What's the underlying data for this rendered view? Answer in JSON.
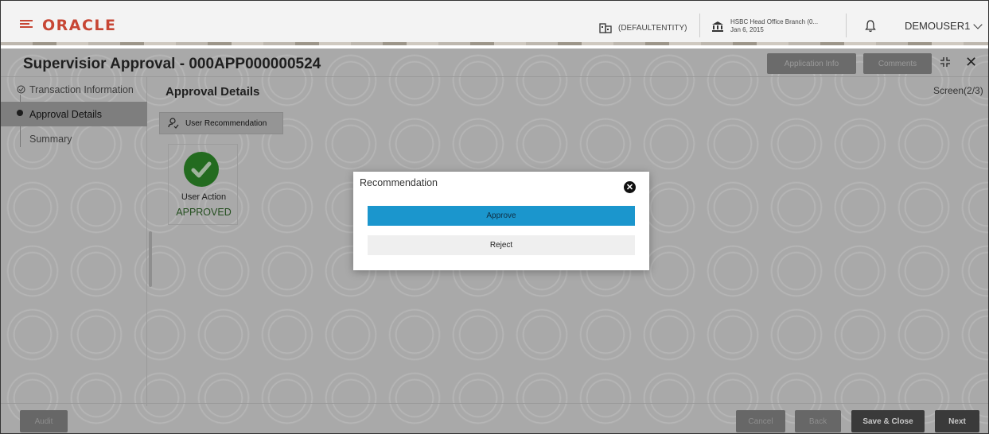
{
  "header": {
    "logo": "ORACLE",
    "entity": "(DEFAULTENTITY)",
    "branch_name": "HSBC Head Office Branch (0...",
    "branch_date": "Jan 6, 2015",
    "user": "DEMOUSER1"
  },
  "page": {
    "title": "Supervisior Approval - 000APP000000524",
    "application_info_label": "Application Info",
    "comments_label": "Comments",
    "section_title": "Approval Details",
    "screen_count": "Screen(2/3)"
  },
  "sidebar": {
    "items": [
      {
        "label": "Transaction Information"
      },
      {
        "label": "Approval Details"
      },
      {
        "label": "Summary"
      }
    ]
  },
  "recommendation_tab": {
    "label": "User Recommendation"
  },
  "action_card": {
    "label": "User Action",
    "value": "APPROVED"
  },
  "footer": {
    "audit_label": "Audit",
    "cancel_label": "Cancel",
    "back_label": "Back",
    "save_close_label": "Save & Close",
    "next_label": "Next"
  },
  "modal": {
    "title": "Recommendation",
    "approve_label": "Approve",
    "reject_label": "Reject"
  },
  "colors": {
    "brand": "#c74634",
    "approve_button": "#1b96cd",
    "approved_status": "#236b1f"
  }
}
